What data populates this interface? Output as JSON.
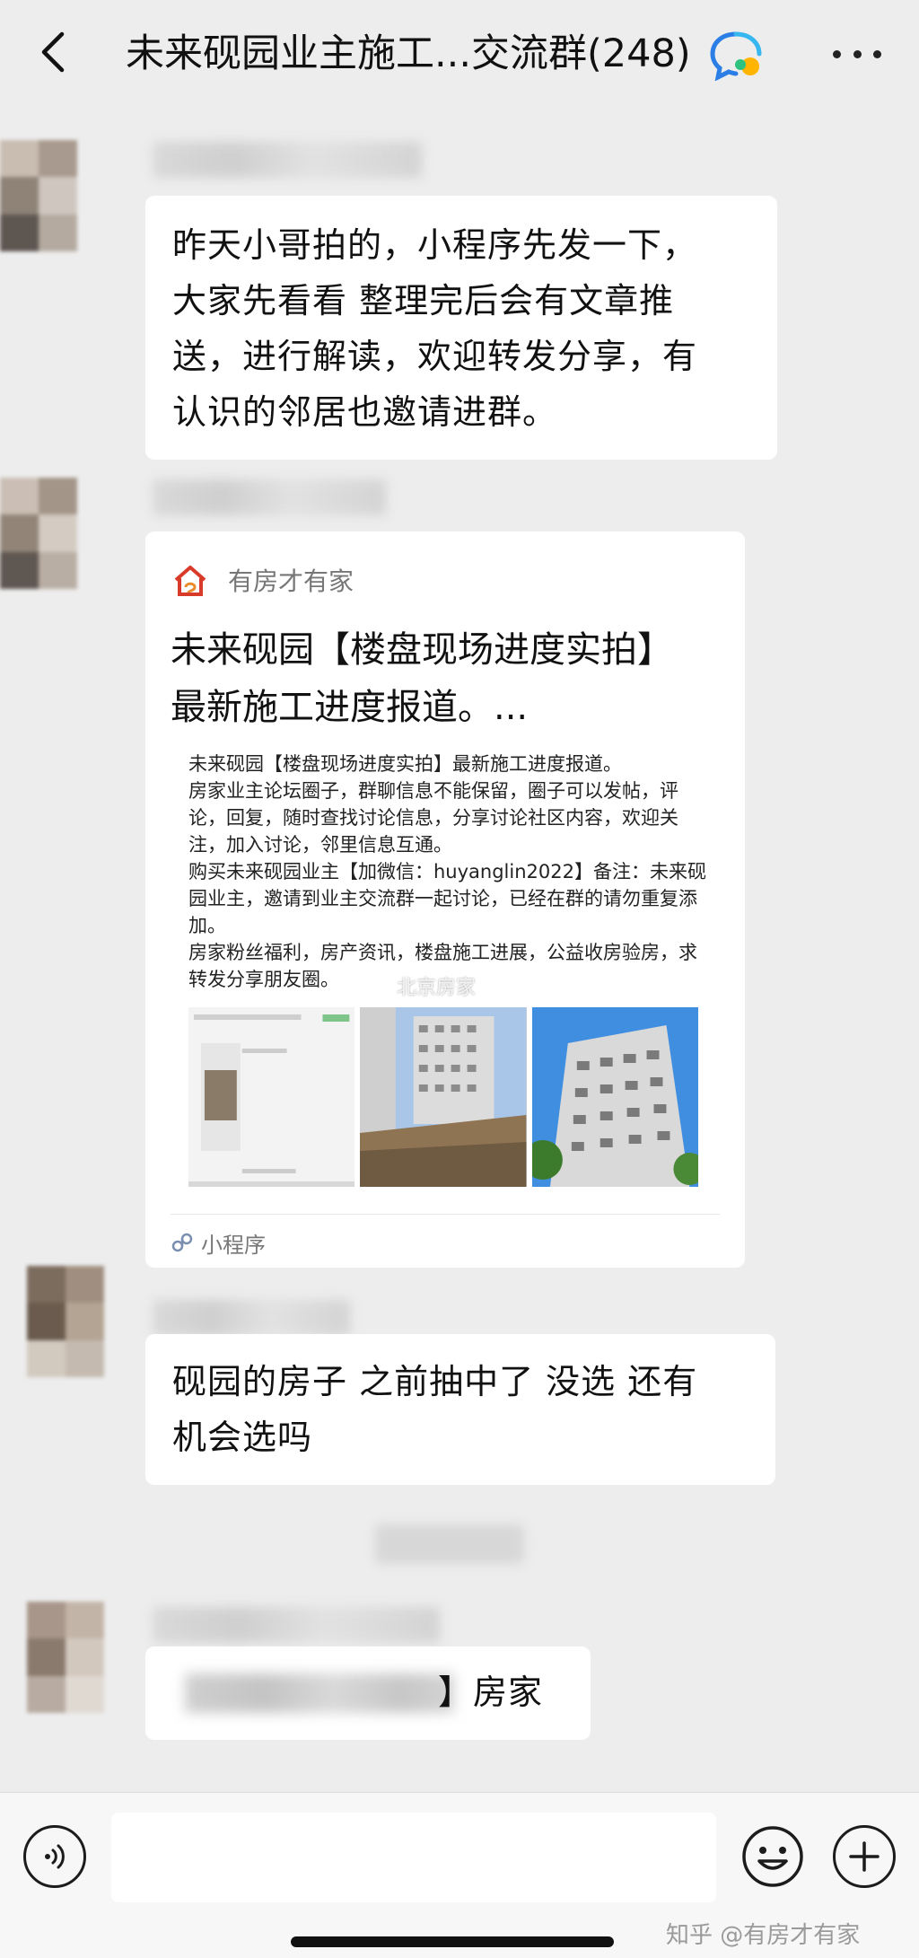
{
  "header": {
    "title": "未来砚园业主施工...交流群(248)"
  },
  "messages": [
    {
      "text": "昨天小哥拍的，小程序先发一下，\n大家先看看 整理完后会有文章推\n送，进行解读，欢迎转发分享，有\n认识的邻居也邀请进群。"
    },
    {
      "card": {
        "source": "有房才有家",
        "title": "未来砚园【楼盘现场进度实拍】\n最新施工进度报道。...",
        "desc": [
          "未来砚园【楼盘现场进度实拍】最新施工进度报道。",
          "房家业主论坛圈子，群聊信息不能保留，圈子可以发帖，评论，回复，随时查找讨论信息，分享讨论社区内容，欢迎关注，加入讨论，邻里信息互通。",
          "购买未来砚园业主【加微信：huyanglin2022】备注：未来砚园业主，邀请到业主交流群一起讨论，已经在群的请勿重复添加。",
          "房家粉丝福利，房产资讯，楼盘施工进展，公益收房验房，求转发分享朋友圈。"
        ],
        "image_watermark": "北京房家",
        "footer": "小程序"
      }
    },
    {
      "text": "砚园的房子 之前抽中了 没选 还有\n机会选吗"
    },
    {
      "text_suffix": "】房家"
    }
  ],
  "watermark": "知乎 @有房才有家",
  "icons": {
    "back": "chevron-left-icon",
    "ai": "chat-bubble-ai-icon",
    "more": "more-dots-icon",
    "voice": "voice-icon",
    "emoji": "emoji-icon",
    "plus": "plus-icon",
    "mini_program": "mini-program-icon"
  },
  "colors": {
    "background": "#ededed",
    "bubble": "#ffffff",
    "card_logo": "#d93b2b"
  }
}
